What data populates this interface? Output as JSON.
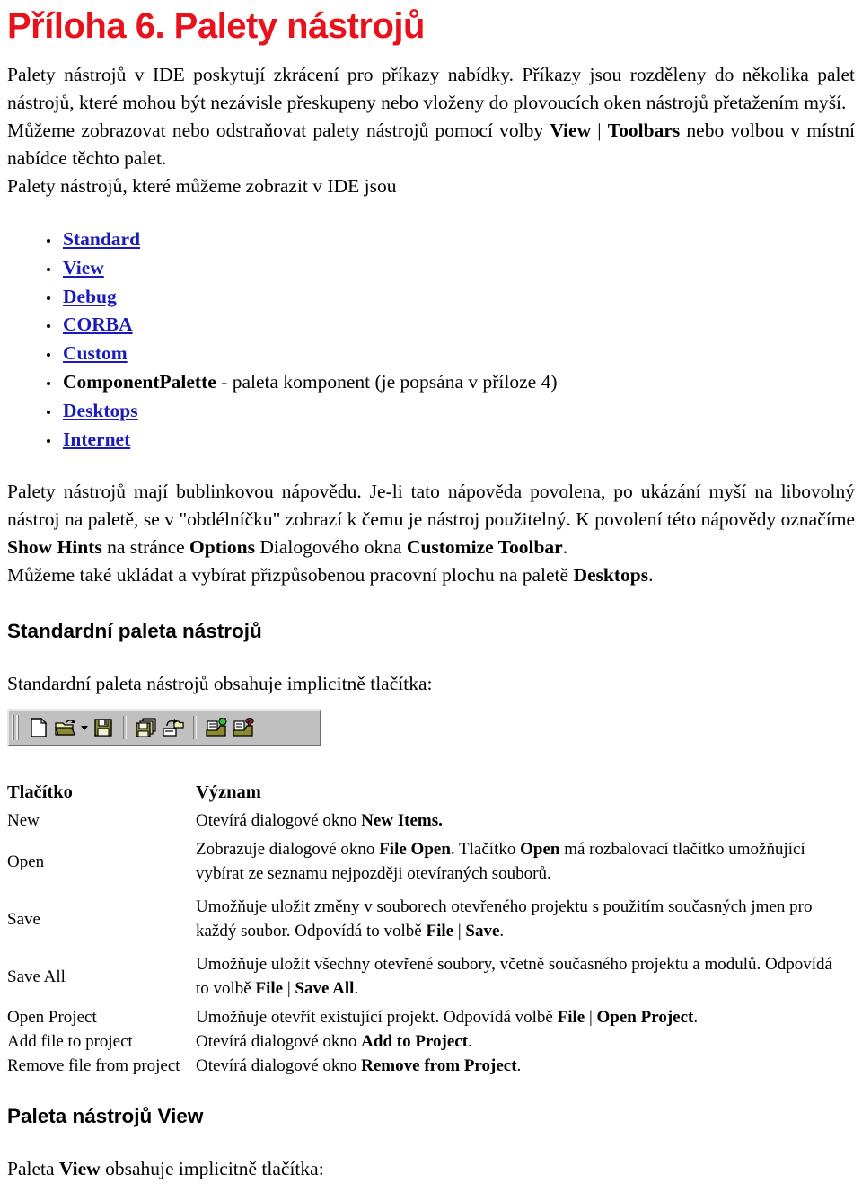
{
  "document": {
    "title": "Příloha 6. Palety nástrojů",
    "title_color": "#e8121c",
    "link_color": "#1b1bbb",
    "paragraphs": {
      "intro_1": "Palety nástrojů v IDE poskytují zkrácení pro příkazy nabídky. Příkazy jsou rozděleny do několika palet nástrojů, které mohou být nezávisle přeskupeny nebo vloženy do plovoucích oken nástrojů přetažením myší.",
      "intro_2_a": "Můžeme zobrazovat nebo odstraňovat palety nástrojů pomocí volby ",
      "intro_2_bold_1": "View",
      "intro_2_pipe": " | ",
      "intro_2_bold_2": "Toolbars",
      "intro_2_b": " nebo volbou v místní nabídce těchto palet.",
      "intro_3": "Palety nástrojů, které můžeme zobrazit v IDE jsou",
      "hints_a": "Palety nástrojů mají bublinkovou nápovědu. Je-li tato nápověda povolena, po ukázání myší na libovolný nástroj na paletě, se v \"obdélníčku\" zobrazí k čemu je nástroj použitelný. K povolení této nápovědy označíme ",
      "hints_bold_1": "Show Hints",
      "hints_b": " na stránce ",
      "hints_bold_2": "Options",
      "hints_c": " Dialogového okna ",
      "hints_bold_3": "Customize Toolbar",
      "hints_d": ".",
      "hints_e": "Můžeme také ukládat a vybírat přizpůsobenou pracovní plochu na paletě ",
      "hints_bold_4": "Desktops",
      "hints_f": ".",
      "standard_intro": "Standardní paleta nástrojů obsahuje implicitně tlačítka:",
      "view_intro_a": "Paleta ",
      "view_intro_bold": "View",
      "view_intro_b": " obsahuje implicitně tlačítka:"
    },
    "palette_list": [
      {
        "label": "Standard",
        "is_link": true,
        "suffix": ""
      },
      {
        "label": "View",
        "is_link": true,
        "suffix": ""
      },
      {
        "label": "Debug",
        "is_link": true,
        "suffix": ""
      },
      {
        "label": "CORBA",
        "is_link": true,
        "suffix": ""
      },
      {
        "label": "Custom",
        "is_link": true,
        "suffix": ""
      },
      {
        "label": "ComponentPalette",
        "is_link": false,
        "suffix": " - paleta komponent (je popsána v příloze 4)"
      },
      {
        "label": "Desktops",
        "is_link": true,
        "suffix": ""
      },
      {
        "label": "Internet",
        "is_link": true,
        "suffix": ""
      }
    ],
    "headings": {
      "standard_toolbar": "Standardní paleta nástrojů",
      "view_toolbar": "Paleta nástrojů View"
    },
    "toolbar_image": {
      "background": "#c0c0c0",
      "buttons": [
        {
          "name": "new-file-icon",
          "tooltip": "New"
        },
        {
          "name": "open-folder-icon",
          "tooltip": "Open"
        },
        {
          "name": "open-dropdown-caret-icon",
          "tooltip": "Open dropdown"
        },
        {
          "name": "save-floppy-icon",
          "tooltip": "Save"
        },
        {
          "name": "save-all-floppies-icon",
          "tooltip": "Save All"
        },
        {
          "name": "open-project-icon",
          "tooltip": "Open Project"
        },
        {
          "name": "add-file-to-project-icon",
          "tooltip": "Add file to project"
        },
        {
          "name": "remove-file-from-project-icon",
          "tooltip": "Remove file from project"
        }
      ]
    },
    "table": {
      "headers": [
        "Tlačítko",
        "Význam"
      ],
      "rows": [
        {
          "button": "New",
          "desc_parts": [
            {
              "t": "Otevírá dialogové okno ",
              "b": false
            },
            {
              "t": "New Items.",
              "b": true
            }
          ]
        },
        {
          "button": "Open",
          "desc_parts": [
            {
              "t": "Zobrazuje dialogové okno ",
              "b": false
            },
            {
              "t": "File Open",
              "b": true
            },
            {
              "t": ". Tlačítko ",
              "b": false
            },
            {
              "t": "Open",
              "b": true
            },
            {
              "t": " má rozbalovací tlačítko umožňující vybírat ze seznamu nejpozději otevíraných souborů.",
              "b": false
            }
          ]
        },
        {
          "button": "Save",
          "desc_parts": [
            {
              "t": "Umožňuje uložit změny v souborech otevřeného projektu s použitím současných jmen pro každý soubor. Odpovídá to volbě ",
              "b": false
            },
            {
              "t": "File",
              "b": true
            },
            {
              "t": " | ",
              "b": false
            },
            {
              "t": "Save",
              "b": true
            },
            {
              "t": ".",
              "b": false
            }
          ]
        },
        {
          "button": "Save All",
          "desc_parts": [
            {
              "t": "Umožňuje uložit všechny otevřené soubory, včetně současného projektu a modulů. Odpovídá to volbě ",
              "b": false
            },
            {
              "t": "File",
              "b": true
            },
            {
              "t": " | ",
              "b": false
            },
            {
              "t": "Save All",
              "b": true
            },
            {
              "t": ".",
              "b": false
            }
          ]
        },
        {
          "button": "Open Project",
          "desc_parts": [
            {
              "t": "Umožňuje otevřít existující projekt. Odpovídá volbě ",
              "b": false
            },
            {
              "t": "File",
              "b": true
            },
            {
              "t": " | ",
              "b": false
            },
            {
              "t": "Open Project",
              "b": true
            },
            {
              "t": ".",
              "b": false
            }
          ]
        },
        {
          "button": "Add file to project",
          "desc_parts": [
            {
              "t": "Otevírá dialogové okno ",
              "b": false
            },
            {
              "t": "Add to Project",
              "b": true
            },
            {
              "t": ".",
              "b": false
            }
          ]
        },
        {
          "button": "Remove file from project",
          "desc_parts": [
            {
              "t": "Otevírá dialogové okno ",
              "b": false
            },
            {
              "t": "Remove from Project",
              "b": true
            },
            {
              "t": ".",
              "b": false
            }
          ]
        }
      ]
    }
  }
}
